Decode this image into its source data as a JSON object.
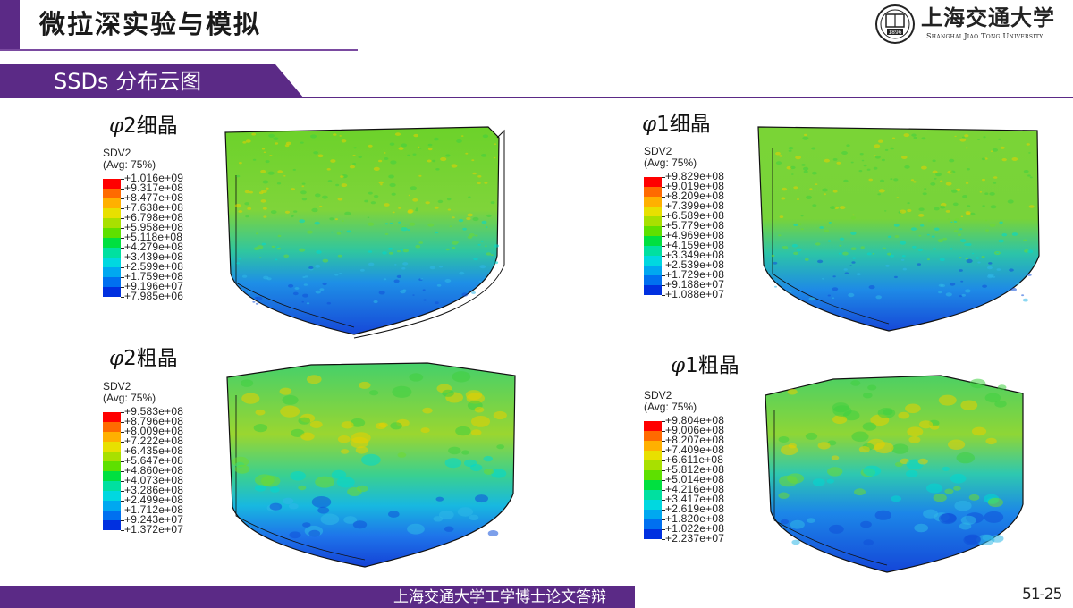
{
  "header": {
    "title": "微拉深实验与模拟",
    "logo_cn": "上海交通大学",
    "logo_en": "Shanghai Jiao Tong University",
    "logo_seal_text": "1896"
  },
  "section": {
    "title": "SSDs 分布云图"
  },
  "panels": [
    {
      "id": "phi2-fine",
      "title_symbol": "φ",
      "title_rest": "2细晶",
      "legend": {
        "var": "SDV2",
        "avg": "(Avg: 75%)",
        "values": [
          "+1.016e+09",
          "+9.317e+08",
          "+8.477e+08",
          "+7.638e+08",
          "+6.798e+08",
          "+5.958e+08",
          "+5.118e+08",
          "+4.279e+08",
          "+3.439e+08",
          "+2.599e+08",
          "+1.759e+08",
          "+9.196e+07",
          "+7.985e+06"
        ]
      }
    },
    {
      "id": "phi1-fine",
      "title_symbol": "φ",
      "title_rest": "1细晶",
      "legend": {
        "var": "SDV2",
        "avg": "(Avg: 75%)",
        "values": [
          "+9.829e+08",
          "+9.019e+08",
          "+8.209e+08",
          "+7.399e+08",
          "+6.589e+08",
          "+5.779e+08",
          "+4.969e+08",
          "+4.159e+08",
          "+3.349e+08",
          "+2.539e+08",
          "+1.729e+08",
          "+9.188e+07",
          "+1.088e+07"
        ]
      }
    },
    {
      "id": "phi2-coarse",
      "title_symbol": "φ",
      "title_rest": "2粗晶",
      "legend": {
        "var": "SDV2",
        "avg": "(Avg: 75%)",
        "values": [
          "+9.583e+08",
          "+8.796e+08",
          "+8.009e+08",
          "+7.222e+08",
          "+6.435e+08",
          "+5.647e+08",
          "+4.860e+08",
          "+4.073e+08",
          "+3.286e+08",
          "+2.499e+08",
          "+1.712e+08",
          "+9.243e+07",
          "+1.372e+07"
        ]
      }
    },
    {
      "id": "phi1-coarse",
      "title_symbol": "φ",
      "title_rest": "1粗晶",
      "legend": {
        "var": "SDV2",
        "avg": "(Avg: 75%)",
        "values": [
          "+9.804e+08",
          "+9.006e+08",
          "+8.207e+08",
          "+7.409e+08",
          "+6.611e+08",
          "+5.812e+08",
          "+5.014e+08",
          "+4.216e+08",
          "+3.417e+08",
          "+2.619e+08",
          "+1.820e+08",
          "+1.022e+08",
          "+2.237e+07"
        ]
      }
    }
  ],
  "colors": {
    "purple": "#5b2a86",
    "legend_swatches": [
      "#ff0000",
      "#ff6a00",
      "#ffb000",
      "#e8e000",
      "#a8e000",
      "#5ee000",
      "#00e040",
      "#00e0a0",
      "#00d8e0",
      "#00a8f0",
      "#0070f0",
      "#0030e0"
    ]
  },
  "footer": {
    "text": "上海交通大学工学博士论文答辩",
    "page": "51-25"
  }
}
